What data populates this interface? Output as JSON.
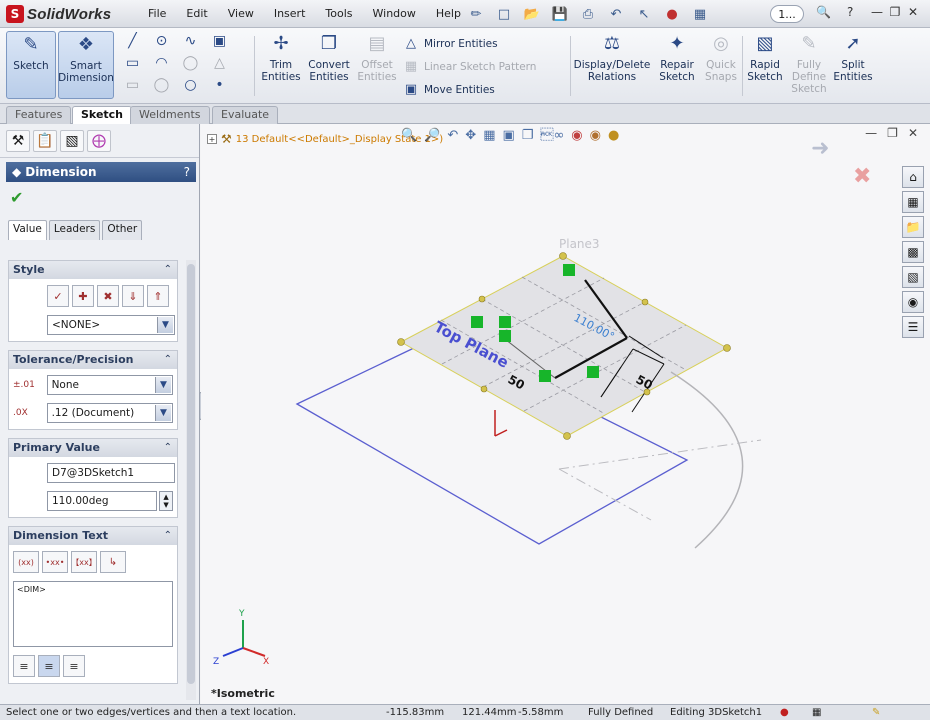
{
  "app": {
    "logo_text": "SolidWorks"
  },
  "menu": [
    "File",
    "Edit",
    "View",
    "Insert",
    "Tools",
    "Window",
    "Help"
  ],
  "search": {
    "label": "1..."
  },
  "toolbar": {
    "sketch": "Sketch",
    "smart_dimension": [
      "Smart",
      "Dimension"
    ],
    "trim": [
      "Trim",
      "Entities"
    ],
    "convert": [
      "Convert",
      "Entities"
    ],
    "offset": [
      "Offset",
      "Entities"
    ],
    "mirror": "Mirror Entities",
    "linear_pattern": "Linear Sketch Pattern",
    "move": "Move Entities",
    "display_delete": [
      "Display/Delete",
      "Relations"
    ],
    "repair": [
      "Repair",
      "Sketch"
    ],
    "quick_snaps": [
      "Quick",
      "Snaps"
    ],
    "rapid": [
      "Rapid",
      "Sketch"
    ],
    "fully_define": [
      "Fully",
      "Define",
      "Sketch"
    ],
    "split": [
      "Split",
      "Entities"
    ]
  },
  "tabs": [
    "Features",
    "Sketch",
    "Weldments",
    "Evaluate"
  ],
  "pm": {
    "title": "Dimension",
    "help": "?",
    "subtabs": [
      "Value",
      "Leaders",
      "Other"
    ],
    "style": {
      "header": "Style",
      "select": "<NONE>"
    },
    "tolerance": {
      "header": "Tolerance/Precision",
      "type": "None",
      "precision": ".12 (Document)"
    },
    "primary": {
      "header": "Primary Value",
      "name": "D7@3DSketch1",
      "value": "110.00deg"
    },
    "dimtext": {
      "header": "Dimension Text",
      "buttons": [
        "(xx)",
        "•xx•",
        "【xx】",
        "↳"
      ],
      "text": "<DIM>"
    }
  },
  "graphics": {
    "tree_text": "13  Default<<Default>_Display State 1>)",
    "plane3": "Plane3",
    "top_plane": "Top Plane",
    "dim_110": "110.00°",
    "dim_50a": "50",
    "dim_50b": "50",
    "view": "*Isometric",
    "axes": {
      "x": "X",
      "y": "Y",
      "z": "Z"
    }
  },
  "status": {
    "message": "Select one or two edges/vertices and then a text location.",
    "x": "-115.83mm",
    "y": "121.44mm",
    "z": "-5.58mm",
    "defined": "Fully Defined",
    "editing": "Editing 3DSketch1"
  }
}
